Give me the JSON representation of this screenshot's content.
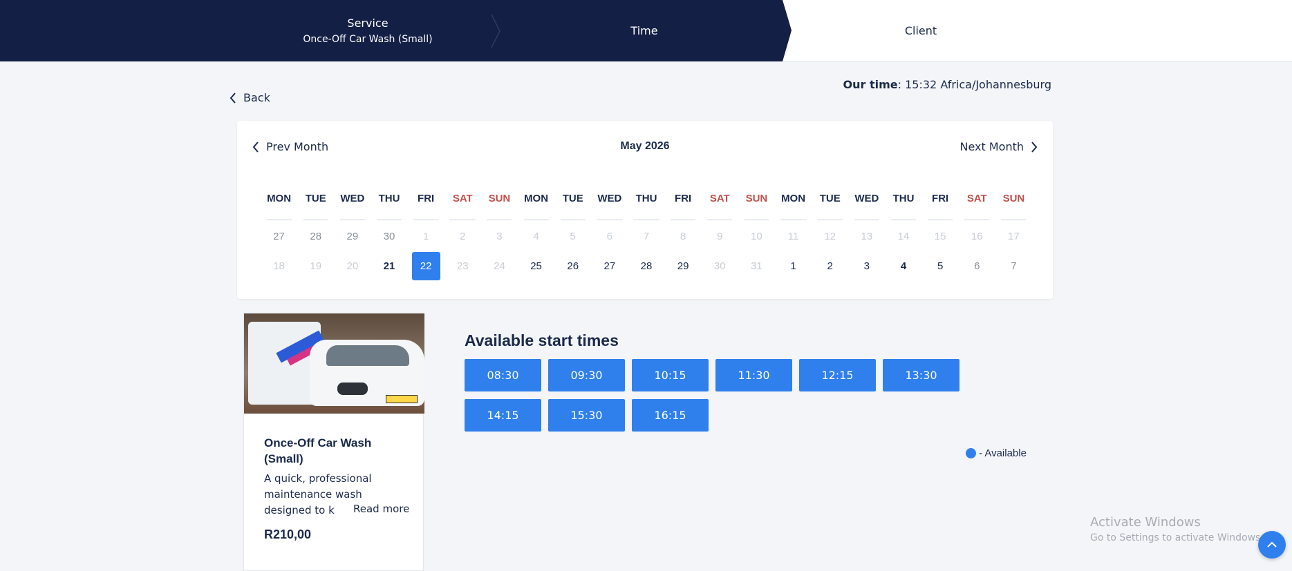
{
  "stepper": {
    "service_label": "Service",
    "service_value": "Once-Off Car Wash (Small)",
    "time_label": "Time",
    "client_label": "Client"
  },
  "back_label": "Back",
  "our_time": {
    "label": "Our time",
    "value": ": 15:32 Africa/Johannesburg"
  },
  "calendar": {
    "prev_label": "Prev Month",
    "next_label": "Next Month",
    "month": "May 2026",
    "weekdays": [
      "MON",
      "TUE",
      "WED",
      "THU",
      "FRI",
      "SAT",
      "SUN",
      "MON",
      "TUE",
      "WED",
      "THU",
      "FRI",
      "SAT",
      "SUN",
      "MON",
      "TUE",
      "WED",
      "THU",
      "FRI",
      "SAT",
      "SUN"
    ],
    "row1": [
      "27",
      "28",
      "29",
      "30",
      "1",
      "2",
      "3",
      "4",
      "5",
      "6",
      "7",
      "8",
      "9",
      "10",
      "11",
      "12",
      "13",
      "14",
      "15",
      "16",
      "17"
    ],
    "row2": [
      "18",
      "19",
      "20",
      "21",
      "22",
      "23",
      "24",
      "25",
      "26",
      "27",
      "28",
      "29",
      "30",
      "31",
      "1",
      "2",
      "3",
      "4",
      "5",
      "6",
      "7"
    ],
    "weekend_color": "#c0504d",
    "selected_day": "22",
    "selected_color": "#2f80ed"
  },
  "service": {
    "title": "Once-Off Car Wash (Small)",
    "description": "A quick, professional maintenance wash designed to k",
    "read_more": "Read more",
    "price": "R210,00"
  },
  "times": {
    "title": "Available start times",
    "slots": [
      "08:30",
      "09:30",
      "10:15",
      "11:30",
      "12:15",
      "13:30",
      "14:15",
      "15:30",
      "16:15"
    ],
    "legend": "- Available"
  },
  "watermark": {
    "line1": "Activate Windows",
    "line2": "Go to Settings to activate Windows."
  },
  "accent_color": "#2f80ed",
  "header_color": "#141f45"
}
